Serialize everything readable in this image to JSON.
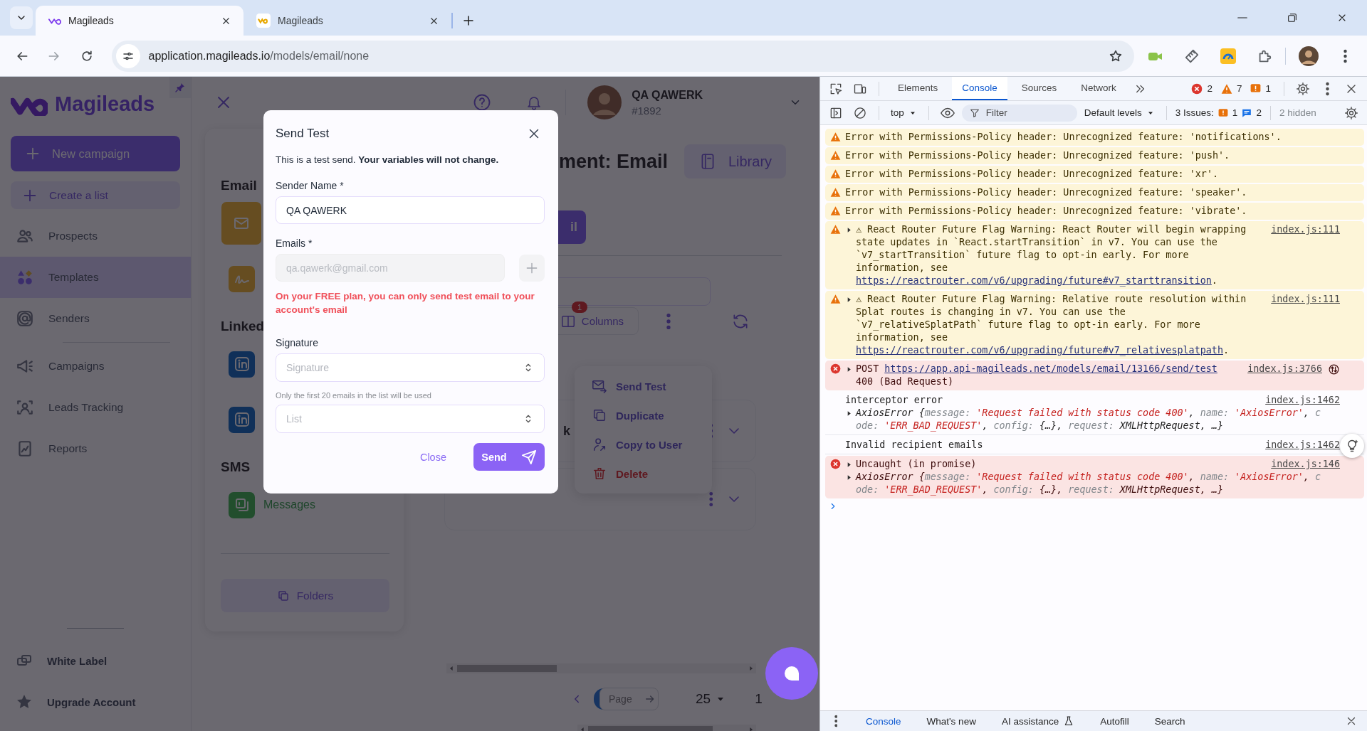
{
  "browser": {
    "tabs": [
      {
        "title": "Magileads",
        "selected": true
      },
      {
        "title": "Magileads",
        "selected": false
      }
    ],
    "address": {
      "host": "application.magileads.io",
      "path": "/models/email/none"
    }
  },
  "sidebar": {
    "brand": "Magileads",
    "new_campaign": "New campaign",
    "create_list": "Create a list",
    "items": [
      {
        "label": "Prospects",
        "selected": false,
        "divider_before": false
      },
      {
        "label": "Templates",
        "selected": true,
        "divider_before": false
      },
      {
        "label": "Senders",
        "selected": false,
        "divider_before": false
      },
      {
        "label": "Campaigns",
        "selected": false,
        "divider_before": true
      },
      {
        "label": "Leads Tracking",
        "selected": false,
        "divider_before": false
      },
      {
        "label": "Reports",
        "selected": false,
        "divider_before": false
      }
    ],
    "bottom_items": [
      {
        "label": "White Label"
      },
      {
        "label": "Upgrade Account"
      }
    ]
  },
  "header": {
    "user_name": "QA QAWERK",
    "user_id": "#1892"
  },
  "panel": {
    "sections": [
      {
        "title": "Email",
        "items": [
          {
            "selected": true
          },
          {
            "selected": false
          }
        ]
      },
      {
        "title": "Linked",
        "items": [
          {
            "selected": false
          },
          {
            "selected": false
          }
        ]
      },
      {
        "title": "SMS",
        "items": [
          {
            "selected": false,
            "label": "Messages"
          }
        ]
      }
    ],
    "folders": "Folders"
  },
  "content": {
    "title": "ment: Email",
    "library": "Library",
    "primary_button": "il",
    "columns": "Columns",
    "columns_badge": "1",
    "rows": [
      {
        "kind": "text",
        "text": "k"
      },
      {
        "kind": "plain"
      }
    ],
    "page_placeholder": "Page",
    "page_size": "25",
    "page": "1"
  },
  "context_menu": [
    {
      "label": "Send Test",
      "danger": false
    },
    {
      "label": "Duplicate",
      "danger": false
    },
    {
      "label": "Copy to User",
      "danger": false
    },
    {
      "label": "Delete",
      "danger": true
    }
  ],
  "modal": {
    "title": "Send Test",
    "intro": "This is a test send. **Your variables will not change.**",
    "sender_label": "Sender Name *",
    "sender_value": "QA QAWERK",
    "emails_label": "Emails *",
    "emails_placeholder": "qa.qawerk@gmail.com",
    "emails_disabled": true,
    "warning": "On your FREE plan, you can only send test email to your account's email",
    "signature_label": "Signature",
    "signature_placeholder": "Signature",
    "list_hint": "Only the first 20 emails in the list will be used",
    "list_placeholder": "List",
    "close": "Close",
    "send": "Send"
  },
  "devtools": {
    "tabs": [
      {
        "label": "Elements",
        "selected": false
      },
      {
        "label": "Console",
        "selected": true
      },
      {
        "label": "Sources",
        "selected": false
      },
      {
        "label": "Network",
        "selected": false
      }
    ],
    "errors": "2",
    "warnings": "7",
    "issues": "1",
    "context": "top",
    "filter_placeholder": "Filter",
    "levels": "Default levels",
    "issues_label": "3 Issues:",
    "issues_warning": "1",
    "issues_info": "2",
    "hidden": "2 hidden",
    "messages": [
      {
        "kind": "warning",
        "expandable": false,
        "text": "Error with Permissions-Policy header: Unrecognized feature: 'notifications'."
      },
      {
        "kind": "warning",
        "expandable": false,
        "text": "Error with Permissions-Policy header: Unrecognized feature: 'push'."
      },
      {
        "kind": "warning",
        "expandable": false,
        "text": "Error with Permissions-Policy header: Unrecognized feature: 'xr'."
      },
      {
        "kind": "warning",
        "expandable": false,
        "text": "Error with Permissions-Policy header: Unrecognized feature: 'speaker'."
      },
      {
        "kind": "warning",
        "expandable": false,
        "text": "Error with Permissions-Policy header: Unrecognized feature: 'vibrate'."
      },
      {
        "kind": "warning",
        "expandable": true,
        "source": "index.js:111",
        "text": "⚠ React Router Future Flag Warning: React Router will begin wrapping state updates in `React.startTransition` in v7. You can use the `v7_startTransition` future flag to opt-in early. For more information, see",
        "link": "https://reactrouter.com/v6/upgrading/future#v7_starttransition",
        "after": "."
      },
      {
        "kind": "warning",
        "expandable": true,
        "source": "index.js:111",
        "text": "⚠ React Router Future Flag Warning: Relative route resolution within Splat routes is changing in v7. You can use the `v7_relativeSplatPath` future flag to opt-in early. For more information, see",
        "link": "https://reactrouter.com/v6/upgrading/future#v7_relativesplatpath",
        "after": "."
      },
      {
        "kind": "error",
        "expandable": true,
        "source": "index.js:3766",
        "network_icon": true,
        "text": "POST",
        "link": "https://app.api-magileads.net/models/email/13166/send/test",
        "after": "400 (Bad Request)"
      },
      {
        "kind": "info",
        "expandable": false,
        "source": "index.js:1462",
        "text": "interceptor error",
        "object": [
          {
            "kind": "plain",
            "text": "AxiosError {"
          },
          {
            "kind": "key",
            "text": "message:"
          },
          {
            "kind": "string",
            "text": " 'Request failed with status code 400'"
          },
          {
            "kind": "plain",
            "text": ", "
          },
          {
            "kind": "key",
            "text": "name:"
          },
          {
            "kind": "string",
            "text": " 'AxiosError'"
          },
          {
            "kind": "plain",
            "text": ", "
          },
          {
            "kind": "key",
            "text": "code:"
          },
          {
            "kind": "string",
            "text": " 'ERR_BAD_REQUEST'"
          },
          {
            "kind": "plain",
            "text": ", "
          },
          {
            "kind": "key",
            "text": "config:"
          },
          {
            "kind": "plain",
            "text": " {…}, "
          },
          {
            "kind": "key",
            "text": "request:"
          },
          {
            "kind": "plain",
            "text": " XMLHttpRequest, …}"
          }
        ]
      },
      {
        "kind": "info",
        "expandable": false,
        "source": "index.js:1462",
        "text": "Invalid recipient emails"
      },
      {
        "kind": "error",
        "expandable": true,
        "source": "index.js:146",
        "text": "Uncaught (in promise)",
        "object": [
          {
            "kind": "plain",
            "text": "AxiosError {"
          },
          {
            "kind": "key",
            "text": "message:"
          },
          {
            "kind": "string",
            "text": " 'Request failed with status code 400'"
          },
          {
            "kind": "plain",
            "text": ", "
          },
          {
            "kind": "key",
            "text": "name:"
          },
          {
            "kind": "string",
            "text": " 'AxiosError'"
          },
          {
            "kind": "plain",
            "text": ", "
          },
          {
            "kind": "key",
            "text": "code:"
          },
          {
            "kind": "string",
            "text": " 'ERR_BAD_REQUEST'"
          },
          {
            "kind": "plain",
            "text": ", "
          },
          {
            "kind": "key",
            "text": "config:"
          },
          {
            "kind": "plain",
            "text": " {…}, "
          },
          {
            "kind": "key",
            "text": "request:"
          },
          {
            "kind": "plain",
            "text": " XMLHttpRequest, …}"
          }
        ]
      }
    ],
    "drawer_tabs": [
      {
        "label": "Console",
        "selected": true
      },
      {
        "label": "What's new",
        "selected": false
      },
      {
        "label": "AI assistance",
        "selected": false
      },
      {
        "label": "Autofill",
        "selected": false
      },
      {
        "label": "Search",
        "selected": false
      }
    ]
  }
}
